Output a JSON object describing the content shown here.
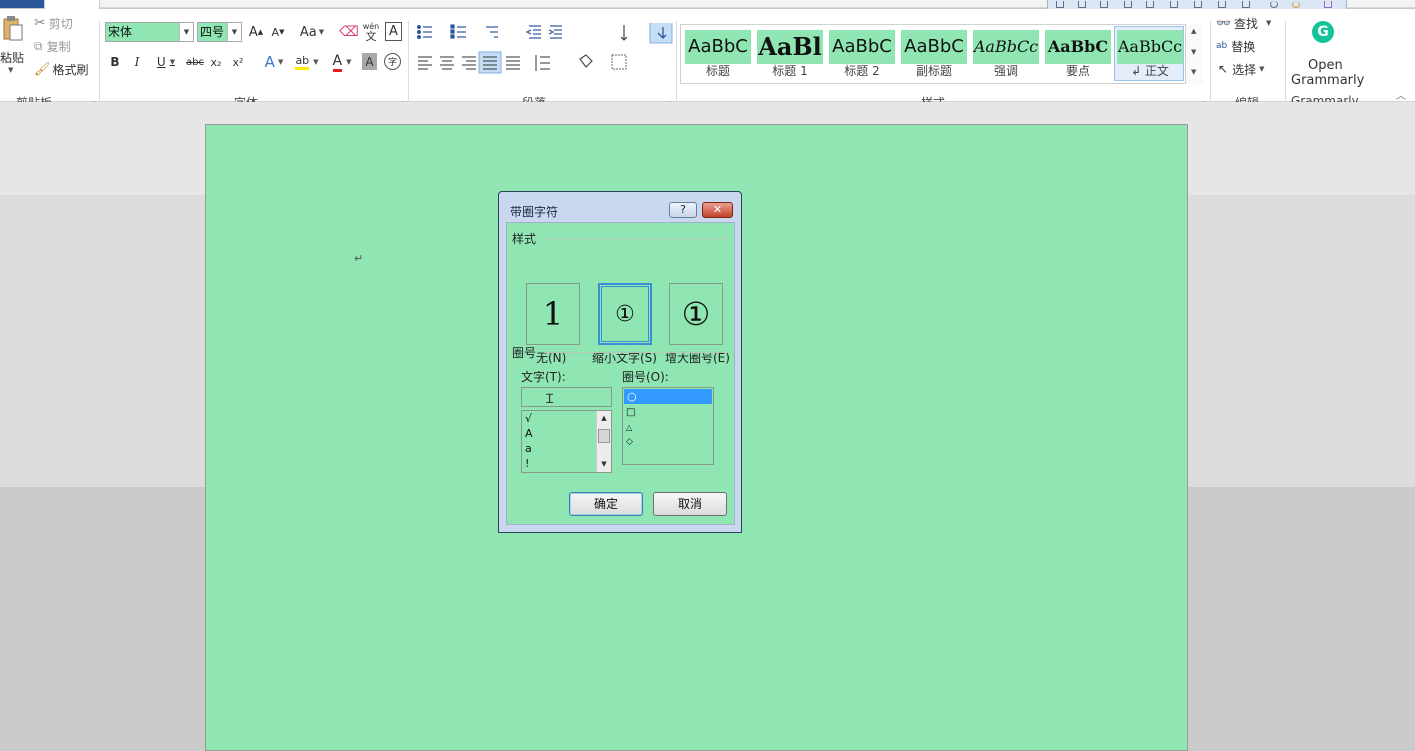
{
  "ribbon": {
    "clipboard": {
      "paste": "粘贴",
      "cut": "剪切",
      "copy": "复制",
      "format_painter": "格式刷",
      "label": "剪贴板"
    },
    "font": {
      "font_name": "宋体",
      "font_size": "四号",
      "grow": "A",
      "shrink": "A",
      "change_case": "Aa",
      "phonetic_top": "wén",
      "phonetic_bottom": "文",
      "char_border": "A",
      "bold": "B",
      "italic": "I",
      "underline": "U",
      "strike": "abc",
      "subscript": "x₂",
      "superscript": "x²",
      "text_effect": "A",
      "highlight": "ab",
      "font_color": "A",
      "char_shading": "A",
      "enclose_char": "字",
      "label": "字体"
    },
    "paragraph": {
      "label": "段落"
    },
    "styles": {
      "label": "样式",
      "items": [
        {
          "preview": "AaBbC",
          "name": "标题"
        },
        {
          "preview": "AaBl",
          "name": "标题 1"
        },
        {
          "preview": "AaBbC",
          "name": "标题 2"
        },
        {
          "preview": "AaBbC",
          "name": "副标题"
        },
        {
          "preview": "AaBbCc",
          "name": "强调"
        },
        {
          "preview": "AaBbC",
          "name": "要点"
        },
        {
          "preview": "AaBbCc",
          "name": "↲ 正文"
        }
      ]
    },
    "editing": {
      "find": "查找",
      "replace": "替换",
      "select": "选择",
      "label": "编辑"
    },
    "grammarly": {
      "open": "Open",
      "name": "Grammarly",
      "label": "Grammarly"
    }
  },
  "document": {
    "paragraph_mark": "↵"
  },
  "dialog": {
    "title": "带圈字符",
    "help": "?",
    "close": "✕",
    "style_section": "样式",
    "styles": [
      {
        "glyph": "1",
        "label": "无(N)",
        "selected": false
      },
      {
        "glyph": "①",
        "label": "缩小文字(S)",
        "selected": true
      },
      {
        "glyph": "①",
        "label": "增大圈号(E)",
        "selected": false
      }
    ],
    "enclose_section": "圈号",
    "text_label": "文字(T):",
    "text_value": "",
    "text_list": [
      "√",
      "A",
      "a",
      "!"
    ],
    "enclosure_label": "圈号(O):",
    "enclosure_list": [
      "○",
      "□",
      "△",
      "◇"
    ],
    "ok": "确定",
    "cancel": "取消"
  },
  "colors": {
    "page_bg": "#8fe6b3",
    "selection": "#3399ff",
    "file_tab": "#2b579a",
    "dialog_frame": "#c9d8ee"
  }
}
